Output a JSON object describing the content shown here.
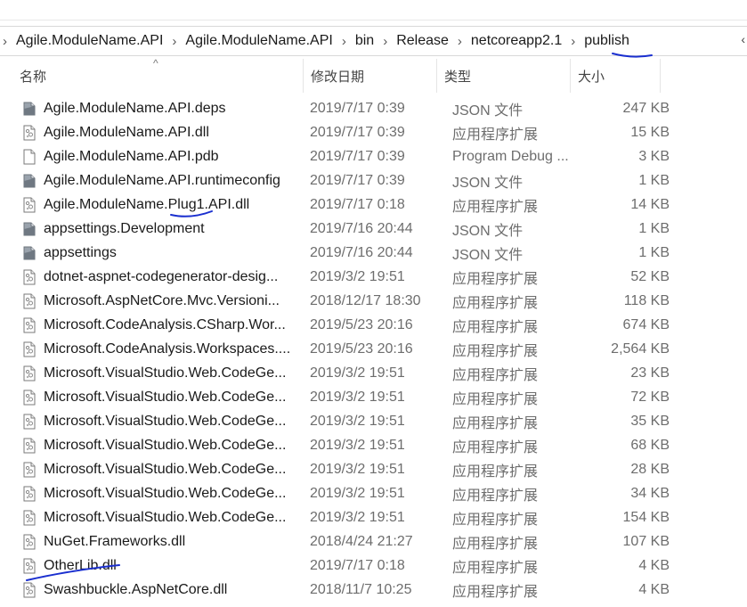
{
  "address": {
    "crumbs": [
      "Agile.ModuleName.API",
      "Agile.ModuleName.API",
      "bin",
      "Release",
      "netcoreapp2.1",
      "publish"
    ]
  },
  "columns": {
    "name": "名称",
    "date": "修改日期",
    "type": "类型",
    "size": "大小"
  },
  "files": [
    {
      "name": "Agile.ModuleName.API.deps",
      "date": "2019/7/17 0:39",
      "type": "JSON 文件",
      "size": "247 KB",
      "icon": "json-file-icon"
    },
    {
      "name": "Agile.ModuleName.API.dll",
      "date": "2019/7/17 0:39",
      "type": "应用程序扩展",
      "size": "15 KB",
      "icon": "dll-file-icon"
    },
    {
      "name": "Agile.ModuleName.API.pdb",
      "date": "2019/7/17 0:39",
      "type": "Program Debug ...",
      "size": "3 KB",
      "icon": "blank-file-icon"
    },
    {
      "name": "Agile.ModuleName.API.runtimeconfig",
      "date": "2019/7/17 0:39",
      "type": "JSON 文件",
      "size": "1 KB",
      "icon": "json-file-icon"
    },
    {
      "name": "Agile.ModuleName.Plug1.API.dll",
      "date": "2019/7/17 0:18",
      "type": "应用程序扩展",
      "size": "14 KB",
      "icon": "dll-file-icon"
    },
    {
      "name": "appsettings.Development",
      "date": "2019/7/16 20:44",
      "type": "JSON 文件",
      "size": "1 KB",
      "icon": "json-file-icon"
    },
    {
      "name": "appsettings",
      "date": "2019/7/16 20:44",
      "type": "JSON 文件",
      "size": "1 KB",
      "icon": "json-file-icon"
    },
    {
      "name": "dotnet-aspnet-codegenerator-desig...",
      "date": "2019/3/2 19:51",
      "type": "应用程序扩展",
      "size": "52 KB",
      "icon": "dll-file-icon"
    },
    {
      "name": "Microsoft.AspNetCore.Mvc.Versioni...",
      "date": "2018/12/17 18:30",
      "type": "应用程序扩展",
      "size": "118 KB",
      "icon": "dll-file-icon"
    },
    {
      "name": "Microsoft.CodeAnalysis.CSharp.Wor...",
      "date": "2019/5/23 20:16",
      "type": "应用程序扩展",
      "size": "674 KB",
      "icon": "dll-file-icon"
    },
    {
      "name": "Microsoft.CodeAnalysis.Workspaces....",
      "date": "2019/5/23 20:16",
      "type": "应用程序扩展",
      "size": "2,564 KB",
      "icon": "dll-file-icon"
    },
    {
      "name": "Microsoft.VisualStudio.Web.CodeGe...",
      "date": "2019/3/2 19:51",
      "type": "应用程序扩展",
      "size": "23 KB",
      "icon": "dll-file-icon"
    },
    {
      "name": "Microsoft.VisualStudio.Web.CodeGe...",
      "date": "2019/3/2 19:51",
      "type": "应用程序扩展",
      "size": "72 KB",
      "icon": "dll-file-icon"
    },
    {
      "name": "Microsoft.VisualStudio.Web.CodeGe...",
      "date": "2019/3/2 19:51",
      "type": "应用程序扩展",
      "size": "35 KB",
      "icon": "dll-file-icon"
    },
    {
      "name": "Microsoft.VisualStudio.Web.CodeGe...",
      "date": "2019/3/2 19:51",
      "type": "应用程序扩展",
      "size": "68 KB",
      "icon": "dll-file-icon"
    },
    {
      "name": "Microsoft.VisualStudio.Web.CodeGe...",
      "date": "2019/3/2 19:51",
      "type": "应用程序扩展",
      "size": "28 KB",
      "icon": "dll-file-icon"
    },
    {
      "name": "Microsoft.VisualStudio.Web.CodeGe...",
      "date": "2019/3/2 19:51",
      "type": "应用程序扩展",
      "size": "34 KB",
      "icon": "dll-file-icon"
    },
    {
      "name": "Microsoft.VisualStudio.Web.CodeGe...",
      "date": "2019/3/2 19:51",
      "type": "应用程序扩展",
      "size": "154 KB",
      "icon": "dll-file-icon"
    },
    {
      "name": "NuGet.Frameworks.dll",
      "date": "2018/4/24 21:27",
      "type": "应用程序扩展",
      "size": "107 KB",
      "icon": "dll-file-icon"
    },
    {
      "name": "OtherLib.dll",
      "date": "2019/7/17 0:18",
      "type": "应用程序扩展",
      "size": "4 KB",
      "icon": "dll-file-icon"
    },
    {
      "name": "Swashbuckle.AspNetCore.dll",
      "date": "2018/11/7 10:25",
      "type": "应用程序扩展",
      "size": "4 KB",
      "icon": "dll-file-icon"
    }
  ],
  "colors": {
    "annotation_ink": "#1a2fcf",
    "icon_gray": "#7a7a7a"
  }
}
